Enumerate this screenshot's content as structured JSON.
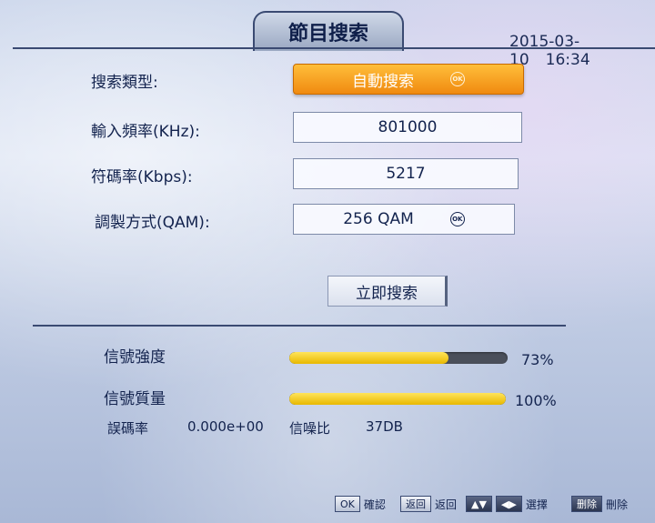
{
  "header": {
    "title": "節目搜索",
    "date": "2015-03-10",
    "time": "16:34"
  },
  "form": {
    "search_type": {
      "label": "搜索類型:",
      "value": "自動搜索",
      "icon": "ok-icon"
    },
    "frequency": {
      "label": "輸入頻率(KHz):",
      "value": "801000"
    },
    "symbol_rate": {
      "label": "符碼率(Kbps):",
      "value": "5217"
    },
    "modulation": {
      "label": "調製方式(QAM):",
      "value": "256 QAM",
      "icon": "ok-icon"
    }
  },
  "actions": {
    "search_now": "立即搜索"
  },
  "signal": {
    "strength_label": "信號強度",
    "strength_value": 73,
    "strength_text": "73%",
    "quality_label": "信號質量",
    "quality_value": 100,
    "quality_text": "100%",
    "ber_label": "誤碼率",
    "ber_value": "0.000e+00",
    "snr_label": "信噪比",
    "snr_value": "37DB"
  },
  "footer": {
    "ok_key": "OK",
    "ok_label": "確認",
    "back_key": "返回",
    "back_label": "返回",
    "updown_key": "▲▼",
    "leftright_key": "◀▶",
    "select_label": "選擇",
    "delete_key": "删除",
    "delete_label": "刪除"
  },
  "colors": {
    "accent_orange": "#f08a10",
    "bar_yellow": "#e8b800",
    "text_navy": "#13234e"
  }
}
